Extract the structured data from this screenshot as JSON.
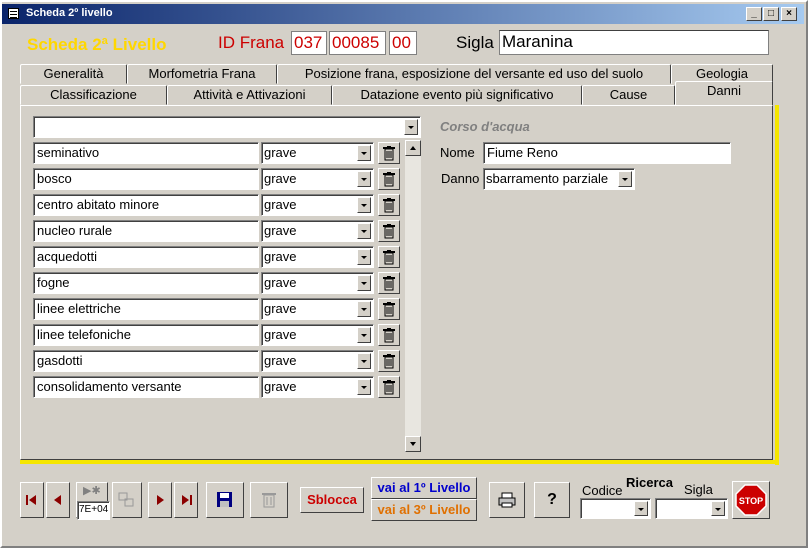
{
  "window": {
    "title": "Scheda 2º livello",
    "min_symbol": "_",
    "max_symbol": "□",
    "close_symbol": "×"
  },
  "header": {
    "form_title": "Scheda 2ª Livello",
    "id_label": "ID Frana",
    "id_parts": [
      "037",
      "00085",
      "00"
    ],
    "sigla_label": "Sigla",
    "sigla_value": "Maranina"
  },
  "tabs_row1": [
    "Generalità",
    "Morfometria Frana",
    "Posizione frana, esposizione del versante ed uso del suolo",
    "Geologia"
  ],
  "tabs_row2": [
    "Classificazione",
    "Attività e Attivazioni",
    "Datazione evento più significativo",
    "Cause",
    "Danni"
  ],
  "active_tab": "Danni",
  "danni_list": {
    "top_value": "",
    "rows": [
      {
        "item": "seminativo",
        "level": "grave"
      },
      {
        "item": "bosco",
        "level": "grave"
      },
      {
        "item": "centro abitato minore",
        "level": "grave"
      },
      {
        "item": "nucleo rurale",
        "level": "grave"
      },
      {
        "item": "acquedotti",
        "level": "grave"
      },
      {
        "item": "fogne",
        "level": "grave"
      },
      {
        "item": "linee elettriche",
        "level": "grave"
      },
      {
        "item": "linee telefoniche",
        "level": "grave"
      },
      {
        "item": "gasdotti",
        "level": "grave"
      },
      {
        "item": "consolidamento versante",
        "level": "grave"
      }
    ]
  },
  "corso_acqua": {
    "section_label": "Corso d'acqua",
    "nome_label": "Nome",
    "nome_value": "Fiume Reno",
    "danno_label": "Danno",
    "danno_value": "sbarramento parziale"
  },
  "footer": {
    "record_field": "7E+04",
    "sblocca_label": "Sblocca",
    "livello1_label": "vai al 1º Livello",
    "livello3_label": "vai al 3º Livello",
    "help_label": "?",
    "ricerca_label": "Ricerca",
    "codice_label": "Codice",
    "sigla_label": "Sigla",
    "codice_value": "",
    "sigla_value": "",
    "stop_label": "STOP"
  },
  "colors": {
    "title_yellow": "#ffd700",
    "id_red": "#cc0000",
    "accent_line": "#f5e600",
    "sblocca_red": "#cc0000",
    "livello1_blue": "#0000cc",
    "livello3_orange": "#e07000",
    "stop_red": "#cc0000"
  }
}
